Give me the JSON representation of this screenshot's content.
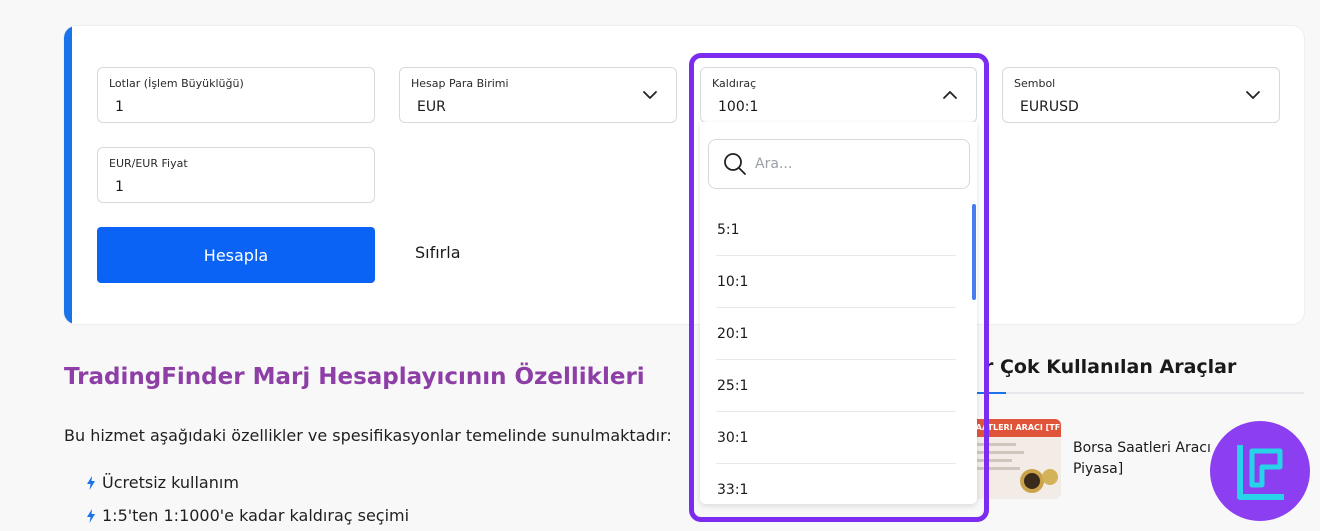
{
  "form": {
    "lots": {
      "label": "Lotlar (İşlem Büyüklüğü)",
      "value": "1"
    },
    "currency": {
      "label": "Hesap Para Birimi",
      "value": "EUR"
    },
    "leverage": {
      "label": "Kaldıraç",
      "value": "100:1"
    },
    "symbol": {
      "label": "Sembol",
      "value": "EURUSD"
    },
    "price": {
      "label": "EUR/EUR Fiyat",
      "value": "1"
    },
    "calculate_label": "Hesapla",
    "reset_label": "Sıfırla"
  },
  "dropdown": {
    "search_placeholder": "Ara...",
    "options": [
      "5:1",
      "10:1",
      "20:1",
      "25:1",
      "30:1",
      "33:1"
    ]
  },
  "content": {
    "heading": "TradingFinder Marj Hesaplayıcının Özellikleri",
    "intro": "Bu hizmet aşağıdaki özellikler ve spesifikasyonlar temelinde sunulmaktadır:",
    "features": [
      "Ücretsiz kullanım",
      "1:5'ten 1:1000'e kadar kaldıraç seçimi"
    ]
  },
  "sidebar": {
    "title": "r Çok Kullanılan Araçlar",
    "tool_thumb_text": "SAATLERI ARACI [TFL",
    "tool_name": "Borsa Saatleri Aracı Piyasa]"
  },
  "colors": {
    "accent": "#1a73e8",
    "button": "#0a63f5",
    "heading": "#8e3fa6",
    "highlight": "#7b2cf0",
    "logo_bg": "#8c3ff0"
  },
  "icons": {
    "dropdown": "chevron-down-icon",
    "dropdown_open": "chevron-up-icon",
    "search": "search-icon",
    "bullet": "lightning-icon",
    "logo": "tradingfinder-logo-icon"
  }
}
